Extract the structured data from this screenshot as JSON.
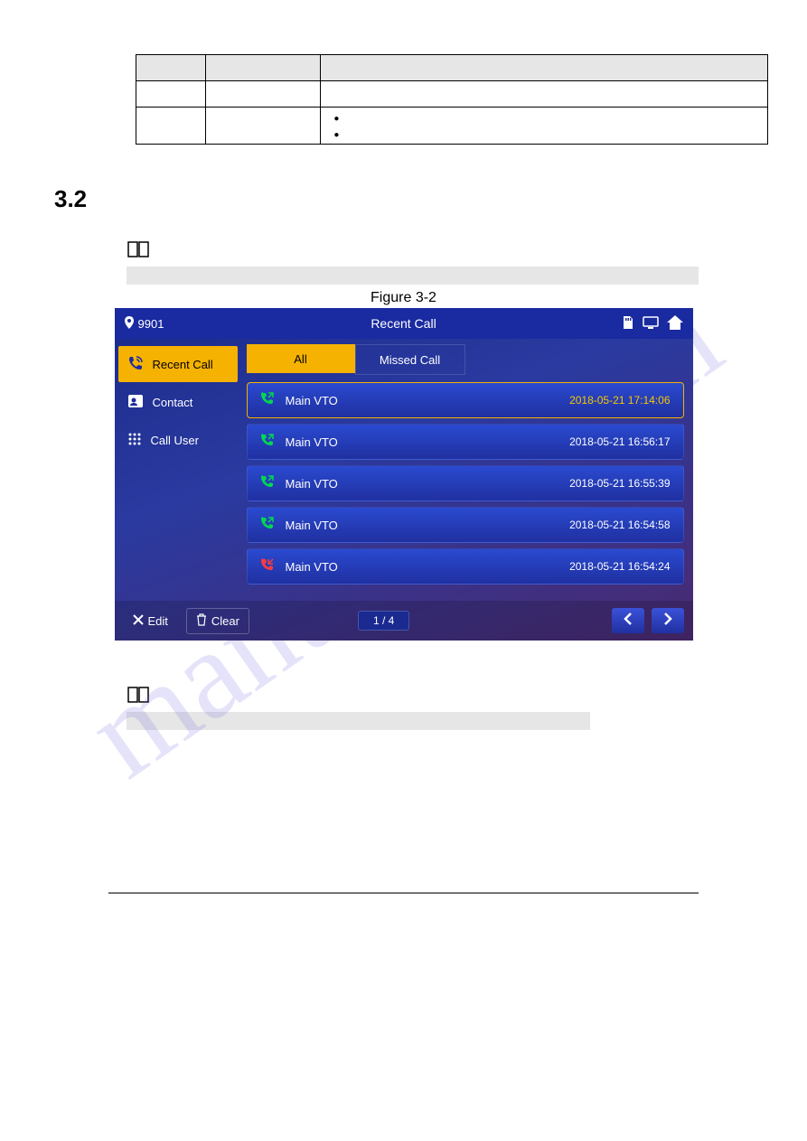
{
  "watermark": "manualzz.com",
  "table": {
    "rows": [
      {
        "c1": "",
        "c2": "",
        "c3": ""
      },
      {
        "c1": "",
        "c2": "",
        "c3": ""
      },
      {
        "c1": "",
        "c2": "",
        "c3_bullets": [
          "",
          ""
        ]
      }
    ]
  },
  "section_number": "3.2",
  "figure_label": "Figure 3-2",
  "ui": {
    "room_id": "9901",
    "title": "Recent Call",
    "sidebar": {
      "items": [
        {
          "label": "Recent Call",
          "active": true,
          "icon": "phone-log"
        },
        {
          "label": "Contact",
          "active": false,
          "icon": "contact"
        },
        {
          "label": "Call User",
          "active": false,
          "icon": "dialpad"
        }
      ]
    },
    "tabs": {
      "all": "All",
      "missed": "Missed Call"
    },
    "calls": [
      {
        "name": "Main VTO",
        "time": "2018-05-21 17:14:06",
        "type": "out",
        "selected": true
      },
      {
        "name": "Main VTO",
        "time": "2018-05-21 16:56:17",
        "type": "out",
        "selected": false
      },
      {
        "name": "Main VTO",
        "time": "2018-05-21 16:55:39",
        "type": "out",
        "selected": false
      },
      {
        "name": "Main VTO",
        "time": "2018-05-21 16:54:58",
        "type": "out",
        "selected": false
      },
      {
        "name": "Main VTO",
        "time": "2018-05-21 16:54:24",
        "type": "missed",
        "selected": false
      }
    ],
    "footer": {
      "edit": "Edit",
      "clear": "Clear",
      "page": "1 / 4"
    }
  }
}
